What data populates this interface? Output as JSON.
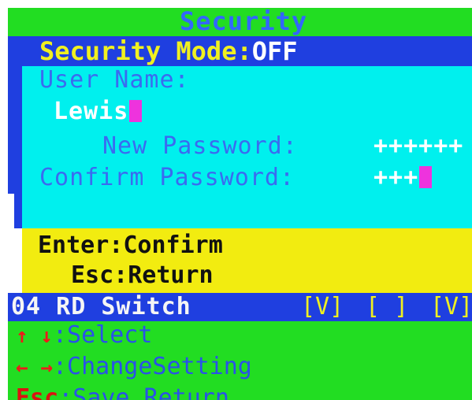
{
  "window": {
    "title": "Security"
  },
  "security_mode": {
    "label": "Security Mode:",
    "value": "OFF"
  },
  "user_name": {
    "label": "User Name:",
    "value": "Lewis"
  },
  "new_password": {
    "label": "New Password:",
    "value": "++++++"
  },
  "confirm_password": {
    "label": "Confirm Password:",
    "value": "+++"
  },
  "prompt": {
    "enter": "Enter:Confirm",
    "esc": "Esc:Return"
  },
  "port_row": {
    "label": "04 RD Switch",
    "marks": [
      "[V]",
      "[ ]",
      "[V]"
    ]
  },
  "help": {
    "select": {
      "arrows": "↑ ↓",
      "text": ":Select"
    },
    "change": {
      "arrows": "← →",
      "text": ":ChangeSetting"
    },
    "save": {
      "key": "Esc",
      "text": ":Save,Return"
    }
  },
  "colors": {
    "title_bar": "#22dd22",
    "mode_bar": "#1f3fe0",
    "form_panel": "#00f0ee",
    "prompt_panel": "#f2ec10",
    "cursor": "#ee33dd"
  }
}
